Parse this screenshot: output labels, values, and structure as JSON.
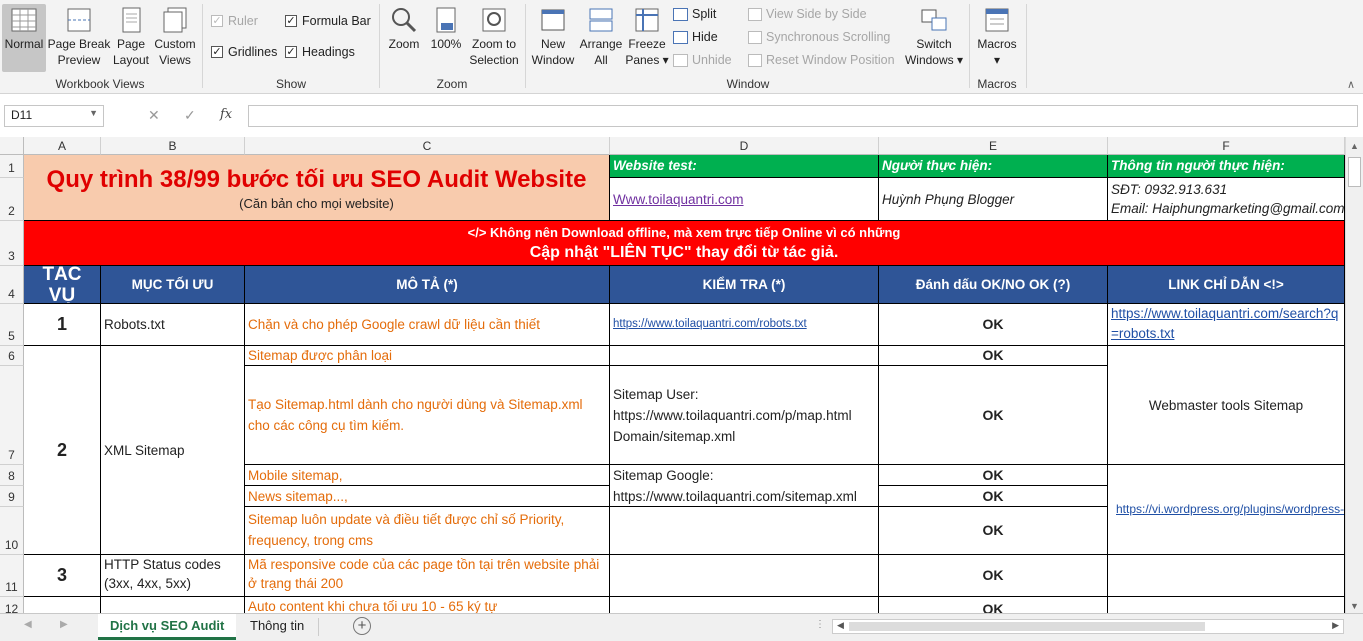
{
  "ribbon": {
    "workbook_views": {
      "normal": "Normal",
      "page_break": "Page Break\nPreview",
      "page_layout": "Page\nLayout",
      "custom_views": "Custom\nViews",
      "group": "Workbook Views"
    },
    "show": {
      "ruler": "Ruler",
      "formula_bar": "Formula Bar",
      "gridlines": "Gridlines",
      "headings": "Headings",
      "group": "Show"
    },
    "zoom": {
      "zoom": "Zoom",
      "zoom100": "100%",
      "zoom_sel": "Zoom to\nSelection",
      "group": "Zoom"
    },
    "window": {
      "new_window": "New\nWindow",
      "arrange": "Arrange\nAll",
      "freeze": "Freeze\nPanes ▾",
      "split": "Split",
      "hide": "Hide",
      "unhide": "Unhide",
      "side": "View Side by Side",
      "sync": "Synchronous Scrolling",
      "reset": "Reset Window Position",
      "switch": "Switch\nWindows ▾",
      "group": "Window"
    },
    "macros": {
      "macros": "Macros\n▾",
      "group": "Macros"
    }
  },
  "formula_bar": {
    "name_box": "D11",
    "fx": "fx",
    "cancel": "✕",
    "enter": "✓",
    "value": ""
  },
  "columns": [
    "A",
    "B",
    "C",
    "D",
    "E",
    "F"
  ],
  "rows": [
    "1",
    "2",
    "3",
    "4",
    "5",
    "6",
    "7",
    "8",
    "9",
    "10",
    "11",
    "12"
  ],
  "sheet": {
    "title": "Quy trình 38/99 bước tối ưu SEO Audit Website",
    "subtitle": "(Căn bản cho mọi website)",
    "website_test_label": "Website test:",
    "website_test_value": "Www.toilaquantri.com",
    "performer_label": "Người thực hiện:",
    "performer_value": "Huỳnh Phụng Blogger",
    "info_label": "Thông tin người thực hiện:",
    "info_phone": "SĐT: 0932.913.631",
    "info_email": "Email: Haiphungmarketing@gmail.com",
    "notice1": "</> Không nên Download offline, mà xem trực tiếp Online vì có những",
    "notice2": "Cập nhật \"LIÊN TỤC\" thay đổi từ tác giả.",
    "headers": [
      "TÁC VỤ",
      "MỤC TỐI ƯU",
      "MÔ TẢ (*)",
      "KIỂM TRA (*)",
      "Đánh dấu OK/NO OK (?)",
      "LINK CHỈ DẪN <!>"
    ],
    "task1": "1",
    "task1_item": "Robots.txt",
    "task1_desc": "Chặn và cho phép Google crawl dữ liệu cần thiết",
    "task1_check": "https://www.toilaquantri.com/robots.txt",
    "task1_mark": "OK",
    "task1_link": "https://www.toilaquantri.com/search?q=robots.txt",
    "task2": "2",
    "task2_item": "XML Sitemap",
    "r6_desc": "Sitemap được phân loại",
    "r6_mark": "OK",
    "r7_desc": "Tạo Sitemap.html dành cho người dùng và Sitemap.xml cho các công cụ tìm kiếm.",
    "r7_check": "Sitemap User:\nhttps://www.toilaquantri.com/p/map.html\nDomain/sitemap.xml",
    "r7_mark": "OK",
    "r7_link": "Webmaster tools Sitemap",
    "r8_desc": "Mobile sitemap,",
    "r8_check": "Sitemap Google:",
    "r8_mark": "OK",
    "r9_desc": "News sitemap...,",
    "r9_check": "https://www.toilaquantri.com/sitemap.xml",
    "r9_mark": "OK",
    "r10_desc": "Sitemap luôn update và điều tiết được chỉ số Priority, frequency, trong cms",
    "r10_mark": "OK",
    "r910_link": "https://vi.wordpress.org/plugins/wordpress-seo/",
    "task3": "3",
    "task3_item": "HTTP Status codes\n(3xx, 4xx, 5xx)",
    "r11_desc": "Mã responsive code của các page tồn tại trên website phải ở trạng thái 200",
    "r11_mark": "OK",
    "r12_desc": "Auto content khi chưa tối ưu 10 - 65 ký tự",
    "r12_mark": "OK"
  },
  "tabs": [
    "Dịch vụ SEO Audit",
    "Thông tin"
  ],
  "new_sheet": "+"
}
